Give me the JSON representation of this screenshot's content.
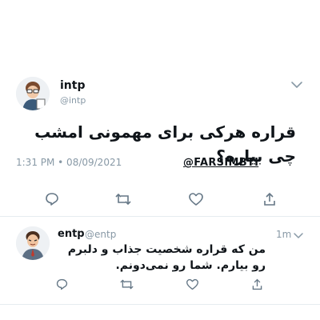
{
  "tweet": {
    "display_name": "intp",
    "handle": "@intp",
    "text": "قراره هرکی برای مهمونی امشب چی بیاره؟",
    "timestamp": "1:31 PM • 08/09/2021",
    "watermark": "@FARSIMBTI",
    "icons": [
      "chevron-down-icon",
      "reply-icon",
      "retweet-icon",
      "like-icon",
      "share-icon"
    ]
  },
  "reply": {
    "display_name": "entp",
    "handle": "@entp",
    "time_ago": "1m",
    "text": "من که قراره شخصیت جذاب و دلبرم رو بیارم. شما رو نمی‌دونم.",
    "icons": [
      "chevron-down-icon",
      "reply-icon",
      "retweet-icon",
      "like-icon",
      "share-icon"
    ]
  },
  "colors": {
    "text": "#0f1419",
    "muted": "#8899a6",
    "divider": "#e6ecf0"
  }
}
